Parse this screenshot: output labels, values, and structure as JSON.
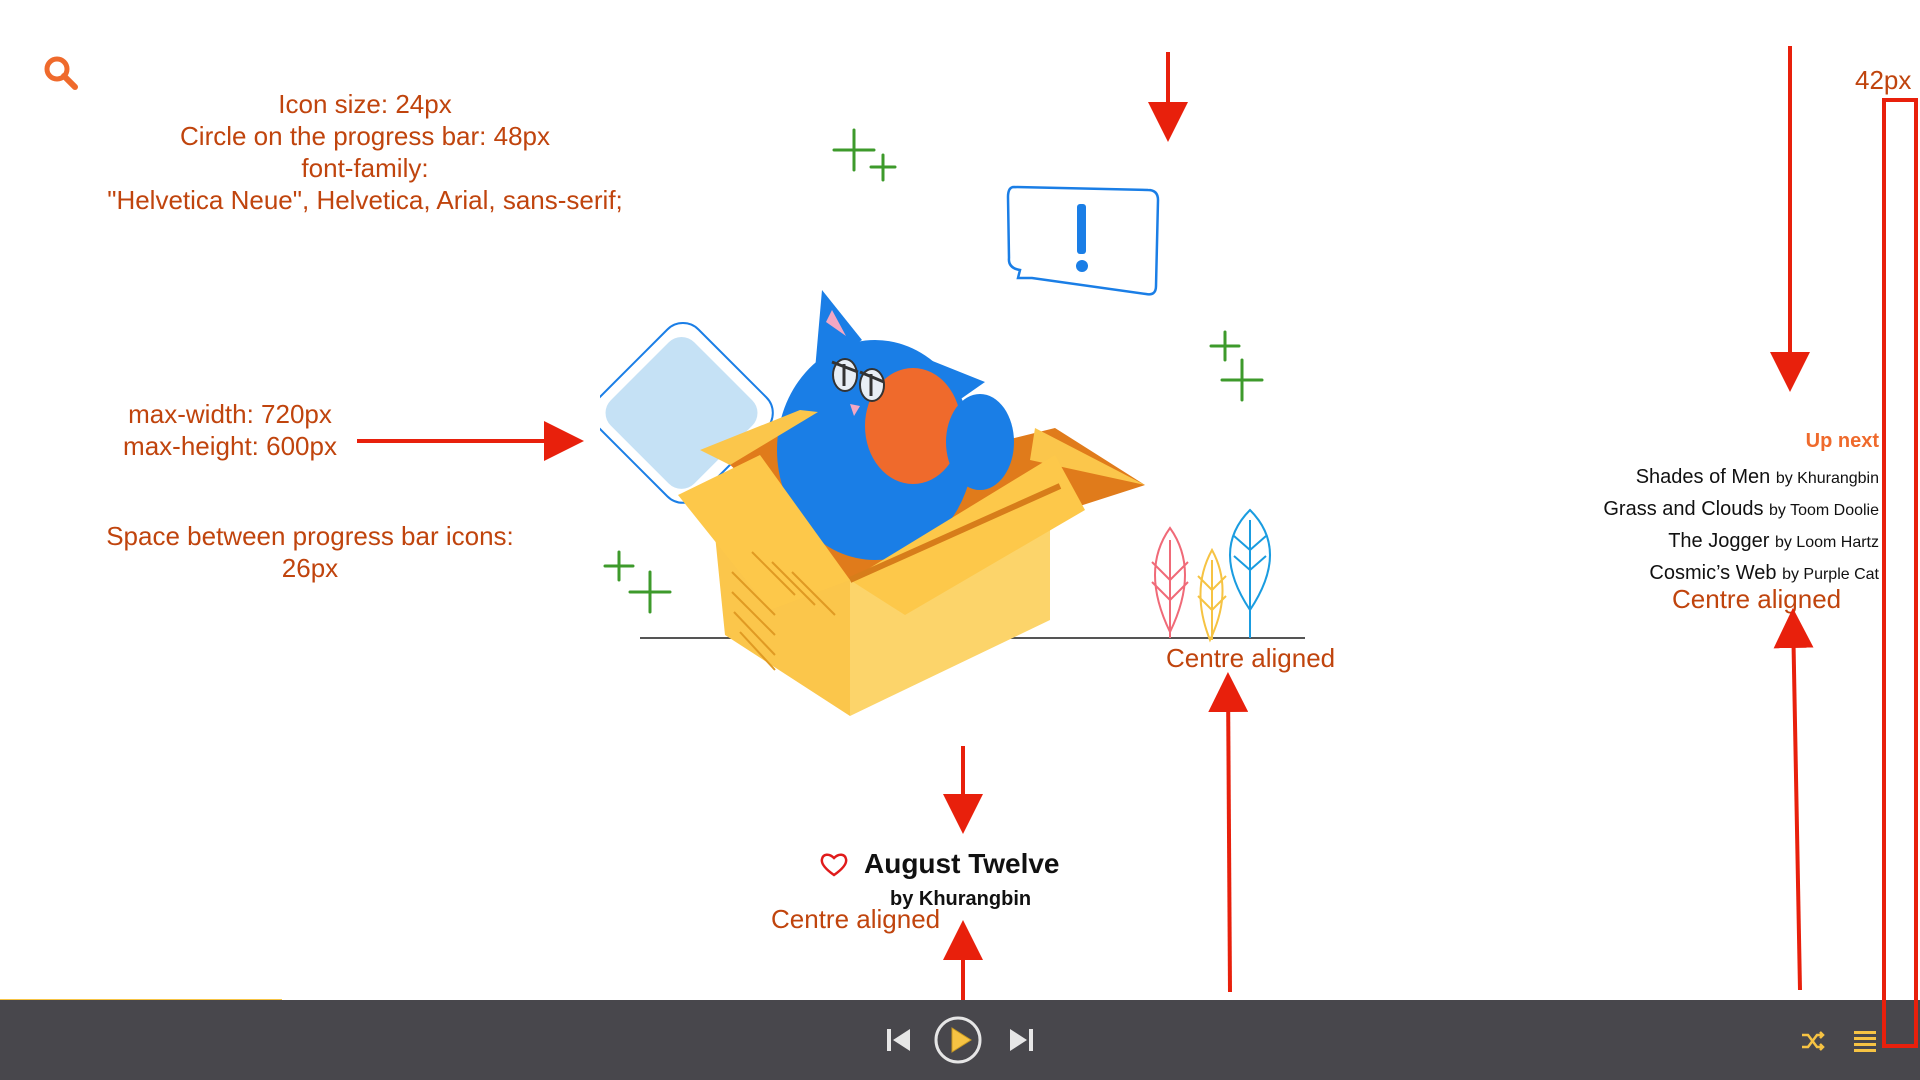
{
  "colors": {
    "accent": "#ef6a2c",
    "annotation": "#c0440d",
    "arrow": "#e8200c",
    "player_bar": "#48474c",
    "progress": "#f6c343",
    "cat": "#1a7ee6",
    "box": "#fbc64b"
  },
  "header": {
    "search_icon": "search-icon"
  },
  "annotations": {
    "specs": [
      "Icon size: 24px",
      "Circle on the progress bar: 48px",
      "font-family:",
      "\"Helvetica Neue\", Helvetica, Arial, sans-serif;"
    ],
    "size": [
      "max-width: 720px",
      "max-height: 600px"
    ],
    "spacing": [
      "Space between progress bar icons:",
      "26px"
    ],
    "width_label": "42px",
    "centre_illustration": "Centre aligned",
    "centre_track": "Centre aligned",
    "centre_queue": "Centre aligned"
  },
  "now_playing": {
    "title": "August Twelve",
    "artist": "by Khurangbin",
    "like_icon": "heart-icon"
  },
  "up_next": {
    "heading": "Up next",
    "items": [
      {
        "title": "Shades of Men",
        "artist": "by Khurangbin"
      },
      {
        "title": "Grass and Clouds",
        "artist": "by Toom Doolie"
      },
      {
        "title": "The Jogger",
        "artist": "by Loom Hartz"
      },
      {
        "title": "Cosmic’s Web",
        "artist": "by Purple Cat"
      }
    ]
  },
  "player": {
    "progress_fraction": 0.147,
    "controls": [
      "previous-icon",
      "play-icon",
      "next-icon",
      "shuffle-icon",
      "queue-icon"
    ]
  }
}
